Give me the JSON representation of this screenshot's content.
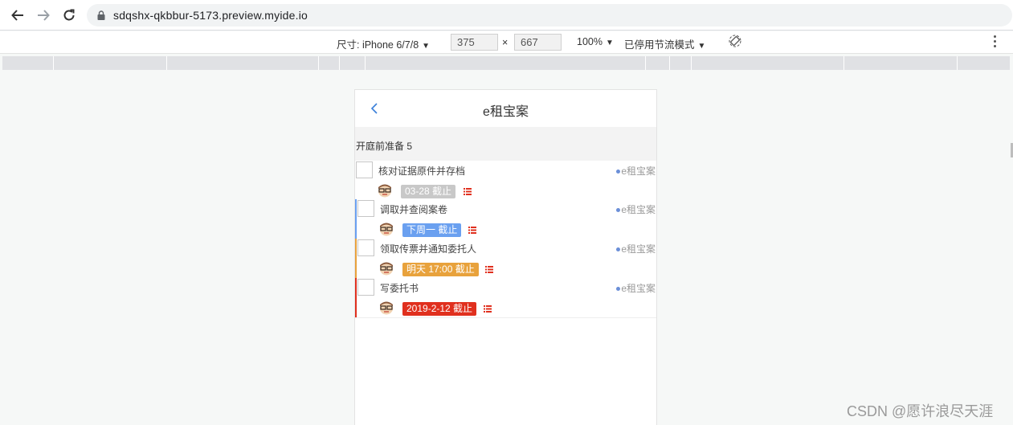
{
  "browser": {
    "url": "sdqshx-qkbbur-5173.preview.myide.io"
  },
  "devtools": {
    "size_label": "尺寸: iPhone 6/7/8",
    "width": "375",
    "height": "667",
    "times": "×",
    "zoom": "100%",
    "throttle": "已停用节流模式"
  },
  "app": {
    "title": "e租宝案",
    "section_title": "开庭前准备 5",
    "tasks": [
      {
        "name": "核对证据原件并存档",
        "source": "e租宝案",
        "deadline": "03-28 截止",
        "color": "#c8c8c8",
        "bar": ""
      },
      {
        "name": "调取并查阅案卷",
        "source": "e租宝案",
        "deadline": "下周一 截止",
        "color": "#6aa0f0",
        "bar": "#6aa0f0"
      },
      {
        "name": "领取传票并通知委托人",
        "source": "e租宝案",
        "deadline": "明天 17:00 截止",
        "color": "#e8a23c",
        "bar": "#e8a23c"
      },
      {
        "name": "写委托书",
        "source": "e租宝案",
        "deadline": "2019-2-12 截止",
        "color": "#e0301e",
        "bar": "#e0301e"
      }
    ]
  },
  "watermark": "CSDN @愿许浪尽天涯"
}
